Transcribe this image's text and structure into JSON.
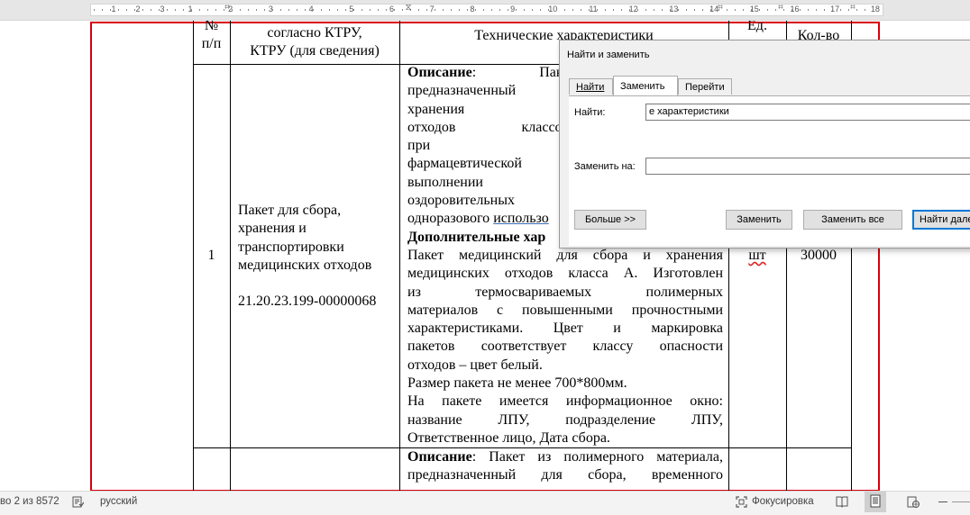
{
  "ruler": {
    "numbers": [
      "1",
      "2",
      "3",
      "1",
      "2",
      "3",
      "4",
      "5",
      "6",
      "7",
      "8",
      "9",
      "10",
      "11",
      "12",
      "13",
      "14",
      "15",
      "16",
      "17",
      "18"
    ],
    "indent_marker": "⧖",
    "tab_marker": "⌗"
  },
  "table": {
    "header": {
      "num": "№\nп/п",
      "ktru": "согласно КТРУ,\nКТРУ (для сведения)",
      "specs": "Технические характеристики",
      "unit": "Ед.",
      "qty": "Кол-во"
    },
    "row1": {
      "num": "1",
      "name": "Пакет для сбора,\nхранения и\nтранспортировки\nмедицинских отходов",
      "code": "21.20.23.199-00000068",
      "desc_label": "Описание",
      "desc_lines": [
        ": Пакет из п",
        "предназначенный для",
        "хранения и транспор",
        "отходов классов А, Б",
        "при осуществлении",
        "фармацевтической",
        "выполнении лечебн",
        "оздоровительных пр",
        "одноразового "
      ],
      "desc_last_underlined": "использо",
      "add_label": "Дополнительные хар",
      "add_lines": [
        "Пакет медицинский для сбора и хранения",
        "медицинских отходов класса А. Изготовлен",
        "из термосвариваемых полимерных",
        "материалов с повышенными прочностными",
        "характеристиками. Цвет и маркировка",
        "пакетов соответствует классу опасности",
        "отходов – цвет белый.",
        "Размер пакета не менее 700*800мм.",
        "На пакете имеется информационное окно:",
        "название ЛПУ, подразделение ЛПУ,",
        "Ответственное лицо, Дата сбора."
      ],
      "unit": "шт",
      "qty": "30000"
    },
    "row2": {
      "desc_label": "Описание",
      "desc_lines": [
        ": Пакет из полимерного материала,",
        "предназначенный для сбора, временного"
      ]
    }
  },
  "dialog": {
    "title": "Найти и заменить",
    "tabs": [
      "Найти",
      "Заменить",
      "Перейти"
    ],
    "active_tab": "Заменить",
    "find_label": "Найти:",
    "find_value": "е характеристики",
    "replace_label": "Заменить на:",
    "replace_value": "",
    "more_button": "Больше >>",
    "replace_button": "Заменить",
    "replace_all_button": "Заменить все",
    "find_next_button": "Найти дале"
  },
  "status": {
    "page": "во 2 из 8572",
    "language": "русский",
    "focus": "Фокусировка"
  }
}
